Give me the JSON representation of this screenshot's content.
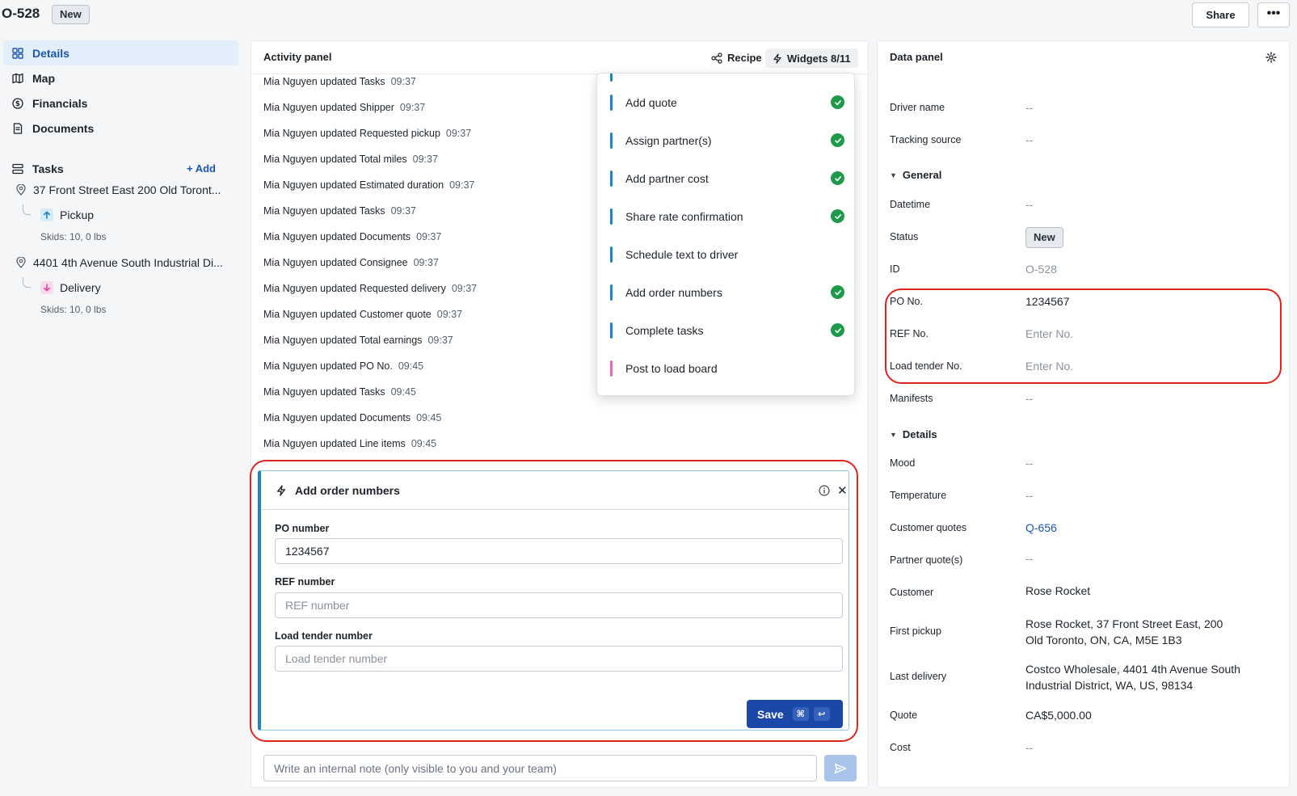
{
  "header": {
    "order_id": "O-528",
    "status_badge": "New",
    "share_label": "Share",
    "more_label": "•••"
  },
  "sidebar": {
    "nav": [
      {
        "label": "Details",
        "icon": "grid-icon",
        "active": true
      },
      {
        "label": "Map",
        "icon": "map-icon"
      },
      {
        "label": "Financials",
        "icon": "dollar-circle-icon"
      },
      {
        "label": "Documents",
        "icon": "document-icon"
      }
    ],
    "tasks_label": "Tasks",
    "add_label": "+ Add",
    "stops": [
      {
        "address": "37 Front Street East 200 Old Toront...",
        "task": "Pickup",
        "task_icon": "arrow-up-icon",
        "skids": "Skids: 10, 0 lbs"
      },
      {
        "address": "4401 4th Avenue South Industrial Di...",
        "task": "Delivery",
        "task_icon": "arrow-down-icon",
        "skids": "Skids: 10, 0 lbs"
      }
    ]
  },
  "activity": {
    "title": "Activity panel",
    "recipe_label": "Recipe",
    "widgets_label": "Widgets 8/11",
    "logs": [
      {
        "text": "Mia Nguyen updated Tasks",
        "time": "09:37"
      },
      {
        "text": "Mia Nguyen updated Shipper",
        "time": "09:37"
      },
      {
        "text": "Mia Nguyen updated Requested pickup",
        "time": "09:37"
      },
      {
        "text": "Mia Nguyen updated Total miles",
        "time": "09:37"
      },
      {
        "text": "Mia Nguyen updated Estimated duration",
        "time": "09:37"
      },
      {
        "text": "Mia Nguyen updated Tasks",
        "time": "09:37"
      },
      {
        "text": "Mia Nguyen updated Documents",
        "time": "09:37"
      },
      {
        "text": "Mia Nguyen updated Consignee",
        "time": "09:37"
      },
      {
        "text": "Mia Nguyen updated Requested delivery",
        "time": "09:37"
      },
      {
        "text": "Mia Nguyen updated Customer quote",
        "time": "09:37"
      },
      {
        "text": "Mia Nguyen updated Total earnings",
        "time": "09:37"
      },
      {
        "text": "Mia Nguyen updated PO No.",
        "time": "09:45"
      },
      {
        "text": "Mia Nguyen updated Tasks",
        "time": "09:45"
      },
      {
        "text": "Mia Nguyen updated Documents",
        "time": "09:45"
      },
      {
        "text": "Mia Nguyen updated Line items",
        "time": "09:45"
      }
    ],
    "widgets_menu": [
      {
        "label": "Add quote",
        "done": true
      },
      {
        "label": "Assign partner(s)",
        "done": true
      },
      {
        "label": "Add partner cost",
        "done": true
      },
      {
        "label": "Share rate confirmation",
        "done": true
      },
      {
        "label": "Schedule text to driver",
        "done": false
      },
      {
        "label": "Add order numbers",
        "done": true
      },
      {
        "label": "Complete tasks",
        "done": true
      },
      {
        "label": "Post to load board",
        "done": false,
        "accent": "pink"
      }
    ],
    "widget_card": {
      "title": "Add order numbers",
      "po_label": "PO number",
      "po_value": "1234567",
      "ref_label": "REF number",
      "ref_placeholder": "REF number",
      "load_label": "Load tender number",
      "load_placeholder": "Load tender number",
      "save_label": "Save",
      "shortcut_cmd": "⌘",
      "shortcut_enter": "↩"
    },
    "note_placeholder": "Write an internal note (only visible to you and your team)"
  },
  "data_panel": {
    "title": "Data panel",
    "fields_top": [
      {
        "label": "Driver name",
        "value": "--"
      },
      {
        "label": "Tracking source",
        "value": "--"
      }
    ],
    "general_label": "General",
    "general": {
      "datetime_label": "Datetime",
      "datetime_value": "--",
      "status_label": "Status",
      "status_value": "New",
      "id_label": "ID",
      "id_value": "O-528",
      "po_label": "PO No.",
      "po_value": "1234567",
      "ref_label": "REF No.",
      "ref_placeholder": "Enter No.",
      "load_label": "Load tender No.",
      "load_placeholder": "Enter No.",
      "manifests_label": "Manifests",
      "manifests_value": "--"
    },
    "details_label": "Details",
    "details": {
      "mood_label": "Mood",
      "mood_value": "--",
      "temp_label": "Temperature",
      "temp_value": "--",
      "cq_label": "Customer quotes",
      "cq_value": "Q-656",
      "pq_label": "Partner quote(s)",
      "pq_value": "--",
      "customer_label": "Customer",
      "customer_value": "Rose Rocket",
      "fp_label": "First pickup",
      "fp_value": "Rose Rocket, 37 Front Street East, 200\nOld Toronto, ON, CA, M5E 1B3",
      "ld_label": "Last delivery",
      "ld_value": "Costco Wholesale, 4401 4th Avenue South\nIndustrial District, WA, US, 98134",
      "quote_label": "Quote",
      "quote_value": "CA$5,000.00",
      "cost_label": "Cost",
      "cost_value": "--"
    }
  },
  "colors": {
    "accent_blue": "#1a56b0",
    "primary_button": "#1a47a8",
    "widget_bar": "#1f86c2",
    "check_green": "#1f9a4b",
    "highlight_red": "#e0231d"
  }
}
